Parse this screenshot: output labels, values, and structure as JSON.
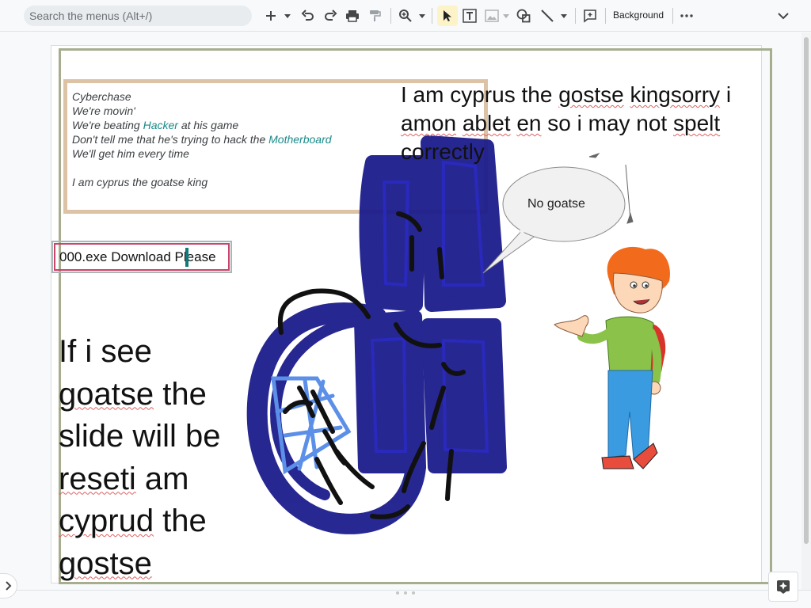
{
  "toolbar": {
    "search_placeholder": "Search the menus (Alt+/)",
    "background_label": "Background",
    "icons": [
      "plus-icon",
      "undo-icon",
      "redo-icon",
      "print-icon",
      "paint-format-icon",
      "zoom-icon",
      "select-arrow-icon",
      "text-box-icon",
      "image-icon",
      "shape-icon",
      "line-icon",
      "comment-icon",
      "more-icon",
      "collapse-chevron-icon"
    ],
    "active_tool": "select-arrow-icon",
    "accent_color": "#fdf3c8"
  },
  "slide": {
    "lyrics": {
      "line1": "Cyberchase",
      "line2": "We're movin'",
      "line3_pre": "We're beating ",
      "line3_link": "Hacker",
      "line3_post": " at his game",
      "line4_pre": "Don't tell me that he's trying to hack the ",
      "line4_link": "Motherboard",
      "line5": "We'll get him every time",
      "line6": "I am cyprus the goatse king"
    },
    "cyprus_text": {
      "w1": "I am cyprus the ",
      "w2": "gostse",
      "w3": " ",
      "w4": "kingsorry",
      "w5": " i ",
      "w6": "amon",
      "w7": " ",
      "w8": "ablet",
      "w9": " ",
      "w10": "en",
      "w11": " so i may not ",
      "w12": "spelt",
      "w13": " correctly"
    },
    "download_text": "000.exe Download Please",
    "goatse_text": {
      "w1": "If i see ",
      "w2": "goatse",
      "w3": " the slide will be ",
      "w4": "reseti",
      "w5": " am ",
      "w6": "cyprud",
      "w7": " the ",
      "w8": "gostse"
    },
    "speech_bubble": "No goatse",
    "colors": {
      "frame": "#a6ae8e",
      "lyrics_border": "#dcc3a6",
      "link": "#1a8a8a",
      "download_border": "#c9436a",
      "scribble_navy": "#1c1c8c",
      "scribble_blue": "#5b8fe8"
    }
  }
}
